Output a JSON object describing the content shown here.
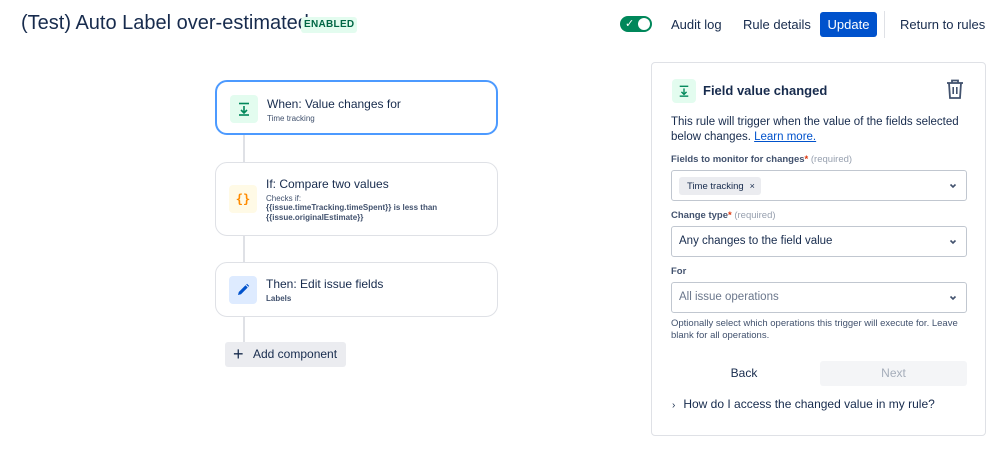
{
  "header": {
    "title": "(Test) Auto Label over-estimated",
    "status_badge": "ENABLED",
    "toggle_on": true,
    "audit_log": "Audit log",
    "rule_details": "Rule details",
    "update": "Update",
    "return_to_rules": "Return to rules"
  },
  "flow": {
    "trigger": {
      "title": "When: Value changes for",
      "subtitle": "Time tracking",
      "icon": "trigger-download-icon"
    },
    "condition": {
      "title": "If: Compare two values",
      "checks_label": "Checks if:",
      "line1": "{{issue.timeTracking.timeSpent}} is less than",
      "line2": "{{issue.originalEstimate}}",
      "icon_text": "{}"
    },
    "action": {
      "title": "Then: Edit issue fields",
      "subtitle": "Labels",
      "icon": "pencil-icon"
    },
    "add_component": "Add component"
  },
  "panel": {
    "title": "Field value changed",
    "description": "This rule will trigger when the value of the fields selected below changes.",
    "learn_more": "Learn more.",
    "fields_label": "Fields to monitor for changes",
    "fields_required": "(required)",
    "fields_tag": "Time tracking",
    "change_type_label": "Change type",
    "change_type_required": "(required)",
    "change_type_value": "Any changes to the field value",
    "for_label": "For",
    "for_placeholder": "All issue operations",
    "help_text": "Optionally select which operations this trigger will execute for. Leave blank for all operations.",
    "back": "Back",
    "next": "Next",
    "faq": "How do I access the changed value in my rule?"
  },
  "colors": {
    "primary": "#0052cc",
    "toggle": "#00875a",
    "badge_bg": "#e3fcef",
    "badge_text": "#006644",
    "selected_border": "#4c9aff"
  }
}
